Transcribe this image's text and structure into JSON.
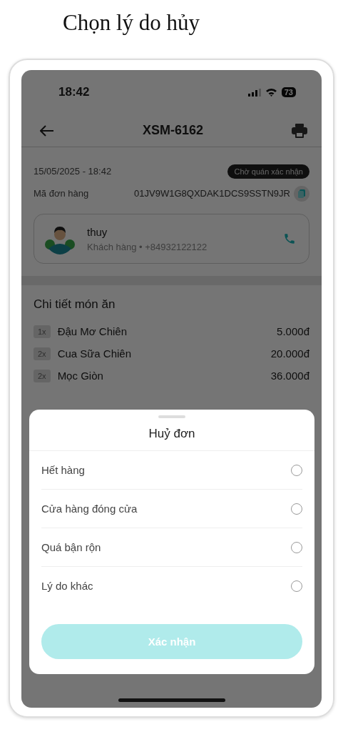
{
  "page_title": "Chọn lý do hủy",
  "status_bar": {
    "time": "18:42",
    "battery": "73"
  },
  "header": {
    "title": "XSM-6162"
  },
  "order": {
    "datetime": "15/05/2025 - 18:42",
    "status": "Chờ quán xác nhận",
    "code_label": "Mã đơn hàng",
    "code": "01JV9W1G8QXDAK1DCS9SSTN9JR"
  },
  "customer": {
    "name": "thuy",
    "subtitle": "Khách hàng • +84932122122"
  },
  "items_section": {
    "title": "Chi tiết món ăn",
    "items": [
      {
        "qty": "1x",
        "name": "Đậu Mơ Chiên",
        "price": "5.000đ"
      },
      {
        "qty": "2x",
        "name": "Cua Sữa Chiên",
        "price": "20.000đ"
      },
      {
        "qty": "2x",
        "name": "Mọc Giòn",
        "price": "36.000đ"
      }
    ]
  },
  "sheet": {
    "title": "Huỷ đơn",
    "reasons": [
      {
        "label": "Hết hàng",
        "selected": false
      },
      {
        "label": "Cửa hàng đóng cửa",
        "selected": false
      },
      {
        "label": "Quá bận rộn",
        "selected": false
      },
      {
        "label": "Lý do khác",
        "selected": false
      }
    ],
    "confirm": {
      "label": "Xác nhận",
      "disabled": true
    }
  }
}
